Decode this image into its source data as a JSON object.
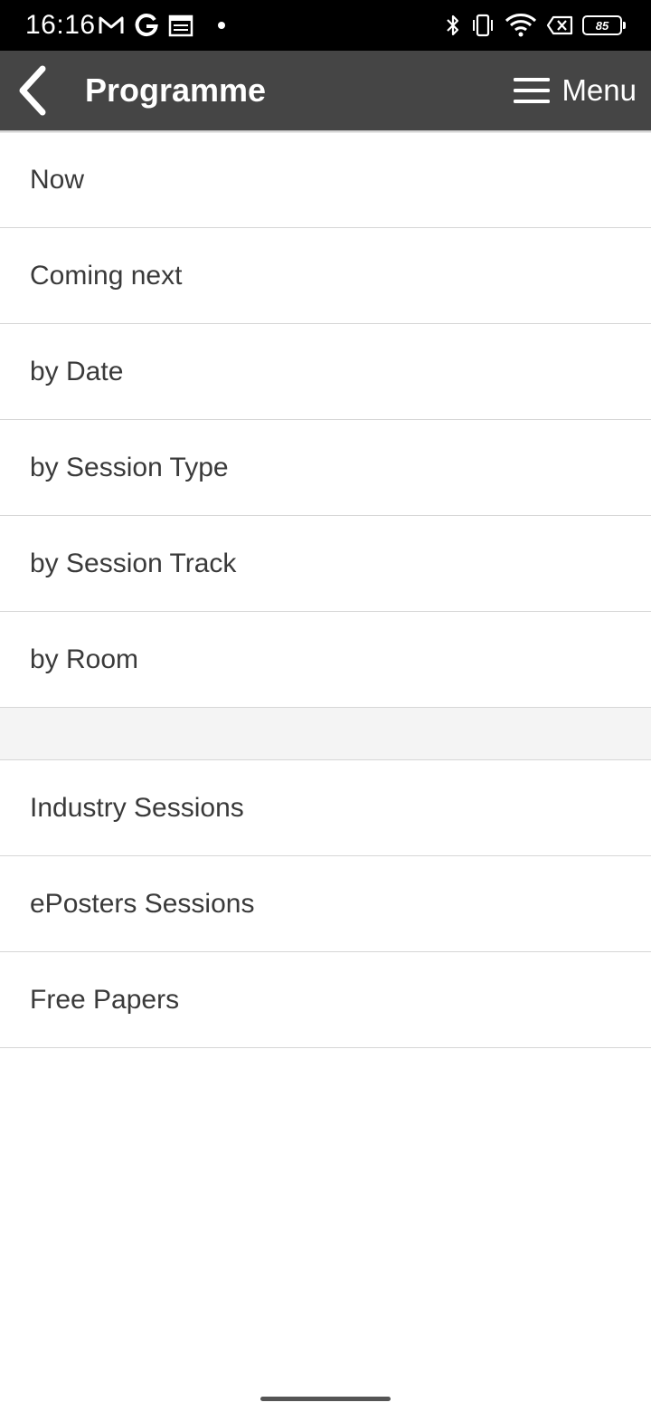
{
  "status_bar": {
    "time": "16:16",
    "battery_level": "85",
    "left_icons": [
      "gmail-icon",
      "google-icon",
      "calendar-icon",
      "notification-dot-icon"
    ],
    "right_icons": [
      "bluetooth-icon",
      "vibrate-icon",
      "wifi-icon",
      "no-sim-icon",
      "battery-icon"
    ]
  },
  "header": {
    "title": "Programme",
    "menu_label": "Menu",
    "background_color": "#454545",
    "text_color": "#ffffff"
  },
  "programme_menu": {
    "primary_items": [
      {
        "label": "Now"
      },
      {
        "label": "Coming next"
      },
      {
        "label": "by Date"
      },
      {
        "label": "by Session Type"
      },
      {
        "label": "by Session Track"
      },
      {
        "label": "by Room"
      }
    ],
    "secondary_items": [
      {
        "label": "Industry Sessions"
      },
      {
        "label": "ePosters Sessions"
      },
      {
        "label": "Free Papers"
      }
    ]
  }
}
